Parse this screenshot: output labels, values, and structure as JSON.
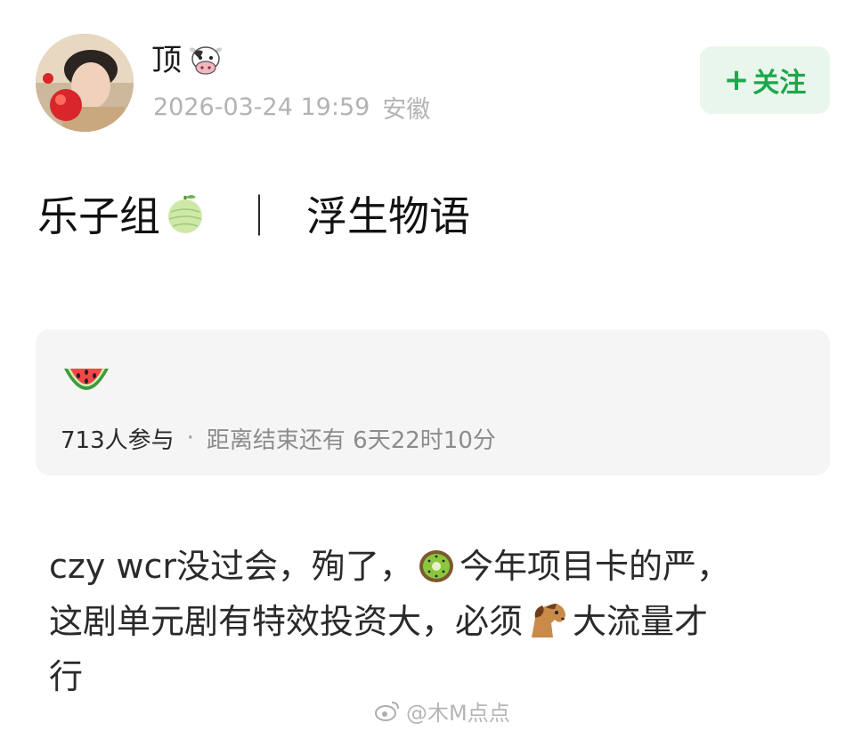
{
  "user": {
    "name": "顶",
    "badge_icon": "cow-face-icon",
    "timestamp": "2026-03-24 19:59",
    "location": "安徽"
  },
  "follow_button": {
    "plus": "+",
    "label": "关注",
    "color": "#1ba84a"
  },
  "post": {
    "title_left": "乐子组",
    "title_emoji": "melon-icon",
    "title_separator": "｜",
    "title_right": "浮生物语",
    "body_lines": [
      {
        "parts": [
          "czy wcr没过会，殉了，",
          "kiwi-icon",
          "今年项目卡的严，"
        ]
      },
      {
        "parts": [
          "这剧单元剧有特效投资大，必须",
          "horse-icon",
          "大流量才"
        ]
      },
      {
        "parts": [
          "行"
        ]
      }
    ],
    "body_text": {
      "l1a": "czy wcr没过会，殉了，",
      "l1b": "今年项目卡的严，",
      "l2a": "这剧单元剧有特效投资大，必须",
      "l2b": "大流量才",
      "l3": "行"
    }
  },
  "vote_card": {
    "emoji": "watermelon-icon",
    "participants": "713人参与",
    "dot": "·",
    "countdown": "距离结束还有 6天22时10分"
  },
  "watermark": {
    "text": "@木M点点",
    "icon": "weibo-icon"
  }
}
